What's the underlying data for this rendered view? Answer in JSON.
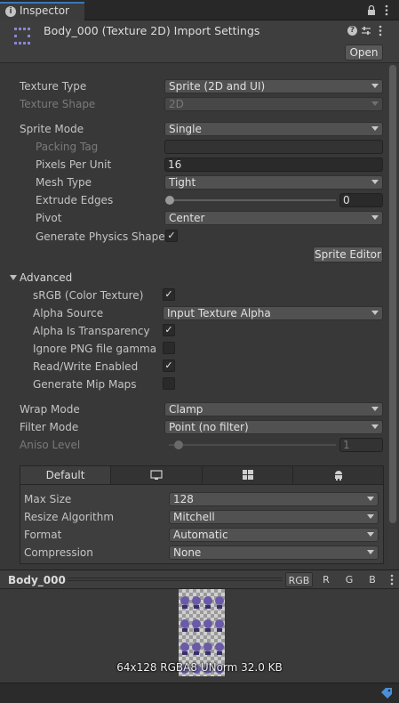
{
  "tab": {
    "label": "Inspector"
  },
  "header": {
    "title": "Body_000 (Texture 2D) Import Settings",
    "open_label": "Open"
  },
  "fields": {
    "texture_type": {
      "label": "Texture Type",
      "value": "Sprite (2D and UI)"
    },
    "texture_shape": {
      "label": "Texture Shape",
      "value": "2D"
    },
    "sprite_mode": {
      "label": "Sprite Mode",
      "value": "Single"
    },
    "packing_tag": {
      "label": "Packing Tag",
      "value": ""
    },
    "pixels_per_unit": {
      "label": "Pixels Per Unit",
      "value": "16"
    },
    "mesh_type": {
      "label": "Mesh Type",
      "value": "Tight"
    },
    "extrude_edges": {
      "label": "Extrude Edges",
      "value": "0"
    },
    "pivot": {
      "label": "Pivot",
      "value": "Center"
    },
    "generate_physics_shape": {
      "label": "Generate Physics Shape",
      "checked": true
    },
    "sprite_editor_label": "Sprite Editor"
  },
  "advanced": {
    "label": "Advanced",
    "srgb": {
      "label": "sRGB (Color Texture)",
      "checked": true
    },
    "alpha_source": {
      "label": "Alpha Source",
      "value": "Input Texture Alpha"
    },
    "alpha_is_transparency": {
      "label": "Alpha Is Transparency",
      "checked": true
    },
    "ignore_png_gamma": {
      "label": "Ignore PNG file gamma",
      "checked": false
    },
    "read_write": {
      "label": "Read/Write Enabled",
      "checked": true
    },
    "mip_maps": {
      "label": "Generate Mip Maps",
      "checked": false
    }
  },
  "wrap": {
    "wrap_mode": {
      "label": "Wrap Mode",
      "value": "Clamp"
    },
    "filter_mode": {
      "label": "Filter Mode",
      "value": "Point (no filter)"
    },
    "aniso_level": {
      "label": "Aniso Level",
      "value": "1"
    }
  },
  "platform": {
    "tabs": [
      "Default",
      "monitor-icon",
      "windows-icon",
      "android-icon"
    ],
    "max_size": {
      "label": "Max Size",
      "value": "128"
    },
    "resize_algorithm": {
      "label": "Resize Algorithm",
      "value": "Mitchell"
    },
    "format": {
      "label": "Format",
      "value": "Automatic"
    },
    "compression": {
      "label": "Compression",
      "value": "None"
    }
  },
  "preview": {
    "name": "Body_000",
    "channels": [
      "RGB",
      "R",
      "G",
      "B"
    ],
    "info": "64x128  RGBA8 UNorm   32.0 KB"
  }
}
